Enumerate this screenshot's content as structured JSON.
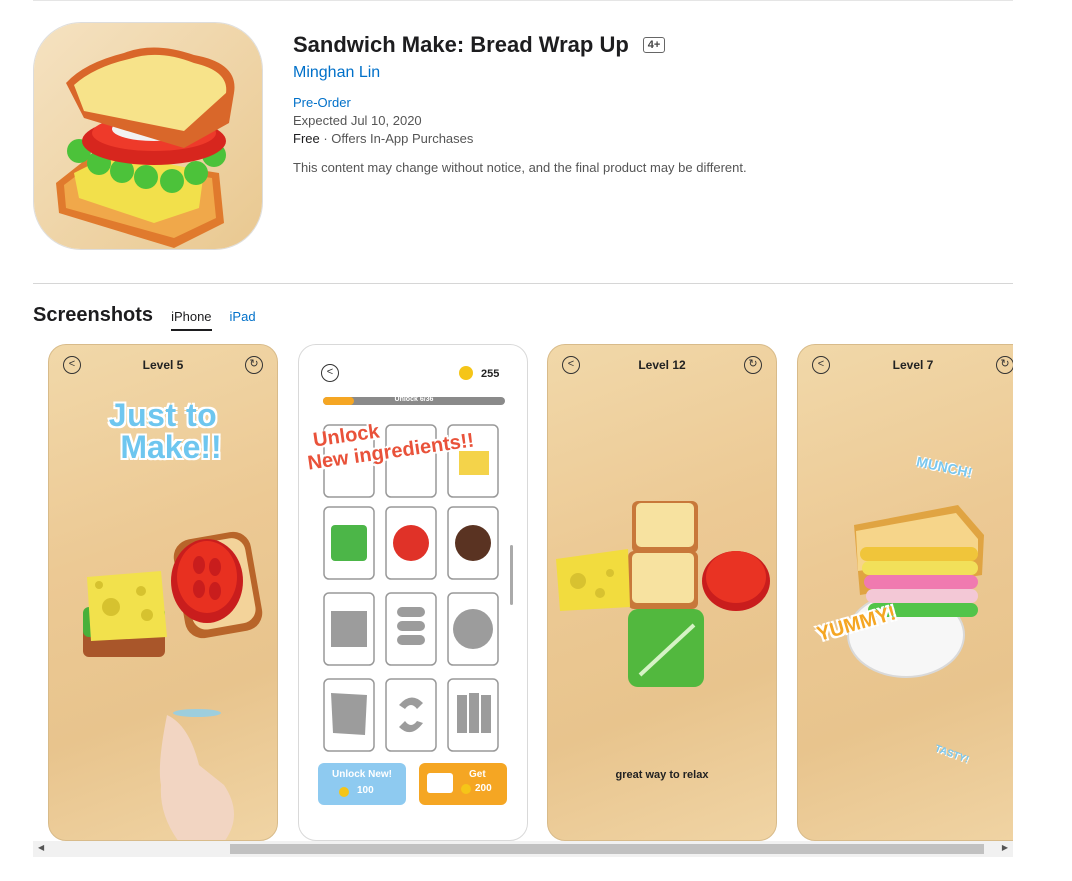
{
  "app": {
    "title": "Sandwich Make: Bread Wrap Up",
    "age_rating": "4+",
    "developer": "Minghan Lin",
    "preorder": "Pre-Order",
    "expected": "Expected Jul 10, 2020",
    "price": "Free",
    "price_extra": " · Offers In-App Purchases",
    "disclaimer": "This content may change without notice, and the final product may be different."
  },
  "screenshots": {
    "heading": "Screenshots",
    "tabs": [
      {
        "label": "iPhone",
        "active": true
      },
      {
        "label": "iPad",
        "active": false
      }
    ],
    "shot1": {
      "level": "Level 5",
      "headline_line1": "Just to",
      "headline_line2": "Make!!"
    },
    "shot2": {
      "coins": "255",
      "progress_label": "Unlock 6/36",
      "progress_fraction": 0.17,
      "banner_line1": "Unlock",
      "banner_line2": "New ingredients!!",
      "unlock_button_line1": "Unlock New!",
      "unlock_button_line2": "100",
      "get_button_line1": "Get",
      "get_button_line2": "200"
    },
    "shot3": {
      "level": "Level 12",
      "caption": "great way to relax"
    },
    "shot4": {
      "level": "Level 7",
      "sticker_1": "MUNCH!",
      "sticker_2": "YUMMY!",
      "sticker_3": "TASTY!"
    }
  },
  "scrollbar": {
    "left_arrow": "◀",
    "right_arrow": "▶"
  }
}
